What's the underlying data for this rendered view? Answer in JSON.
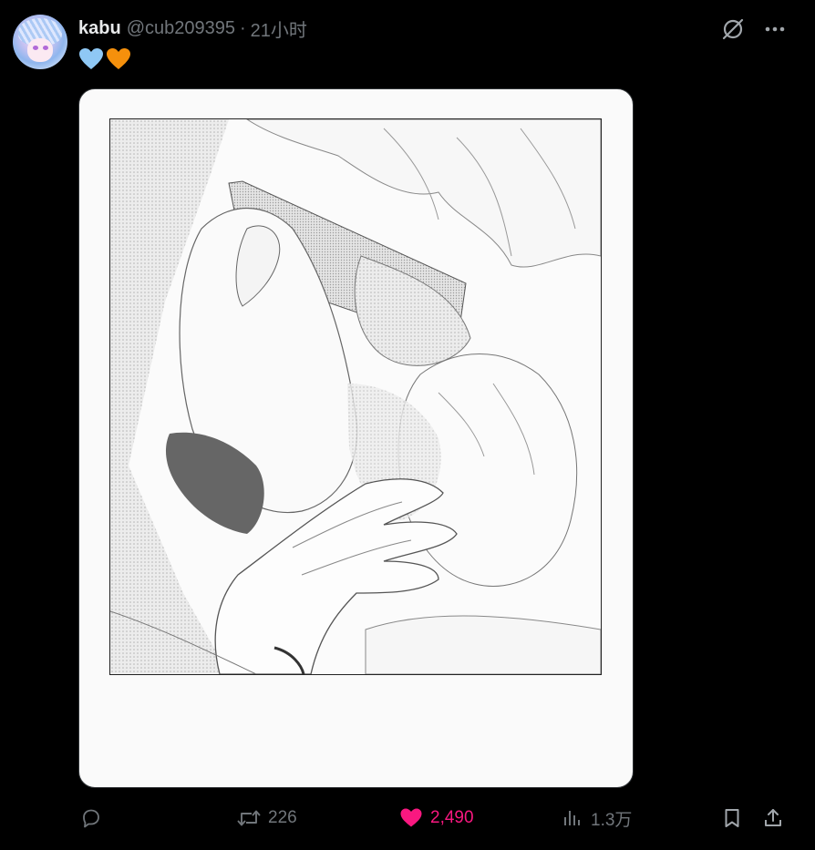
{
  "tweet": {
    "author": {
      "display_name": "kabu",
      "handle": "@cub209395",
      "separator": "·",
      "time": "21小时"
    },
    "content": {
      "emojis": [
        "blue-heart",
        "orange-heart"
      ]
    },
    "media": {
      "type": "manga-illustration"
    },
    "actions": {
      "reply_count": "",
      "repost_count": "226",
      "like_count": "2,490",
      "view_count": "1.3万"
    }
  },
  "colors": {
    "background": "#000000",
    "primary_text": "#e7e9ea",
    "secondary_text": "#71767b",
    "like_active": "#f91880",
    "blue_heart": "#8fc8f5",
    "orange_heart": "#f5900c"
  },
  "icons": {
    "grok": "grok-icon",
    "more": "more-icon",
    "reply": "reply-icon",
    "repost": "repost-icon",
    "like": "like-icon",
    "views": "views-icon",
    "bookmark": "bookmark-icon",
    "share": "share-icon"
  }
}
